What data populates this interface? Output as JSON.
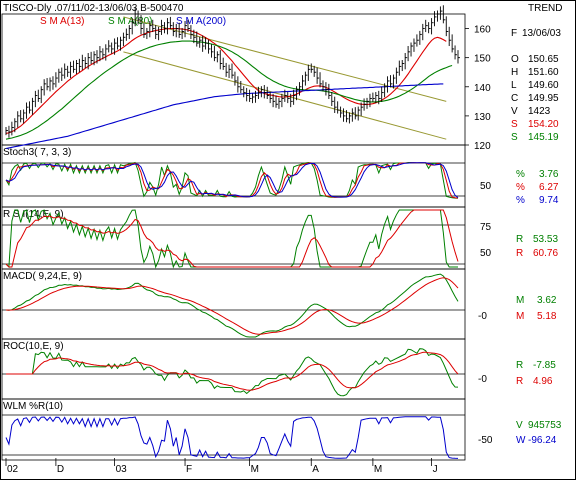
{
  "header": {
    "title": "TISCO-Dly .07/11/02-13/06/03  B-500470",
    "trend_label": "TREND",
    "sma13": "S M A(13)",
    "sma30": "S M A(30)",
    "sma200": "S M A(200)"
  },
  "info": [
    {
      "key": "F",
      "value": "13/06/03",
      "color": "#000000"
    },
    {
      "key": "O",
      "value": "150.65",
      "color": "#000000"
    },
    {
      "key": "H",
      "value": "151.60",
      "color": "#000000"
    },
    {
      "key": "L",
      "value": "149.60",
      "color": "#000000"
    },
    {
      "key": "C",
      "value": "149.95",
      "color": "#000000"
    },
    {
      "key": "V",
      "value": "1423",
      "color": "#000000"
    },
    {
      "key": "S",
      "value": "154.20",
      "color": "#dd0000"
    },
    {
      "key": "S",
      "value": "145.19",
      "color": "#008000"
    }
  ],
  "colors": {
    "sma13": "#dd0000",
    "sma30": "#008000",
    "sma200": "#0000cc",
    "trendline": "#999933",
    "price": "#000000"
  },
  "panels": {
    "stoch": {
      "title": "Stoch3( 7, 3, 3)",
      "axis": [
        "50"
      ],
      "readouts": [
        {
          "key": "%",
          "value": "3.76",
          "color": "#008000"
        },
        {
          "key": "%",
          "value": "6.27",
          "color": "#dd0000"
        },
        {
          "key": "%",
          "value": "9.74",
          "color": "#0000cc"
        }
      ]
    },
    "rsi": {
      "title": "R S I(14,E, 9)",
      "axis": [
        "75",
        "50"
      ],
      "readouts": [
        {
          "key": "R",
          "value": "53.53",
          "color": "#008000"
        },
        {
          "key": "R",
          "value": "60.76",
          "color": "#dd0000"
        }
      ]
    },
    "macd": {
      "title": "MACD( 9,24,E, 9)",
      "axis": [
        "-0"
      ],
      "readouts": [
        {
          "key": "M",
          "value": "3.62",
          "color": "#008000"
        },
        {
          "key": "M",
          "value": "5.18",
          "color": "#dd0000"
        }
      ]
    },
    "roc": {
      "title": "ROC(10,E, 9)",
      "axis": [
        "-0"
      ],
      "readouts": [
        {
          "key": "R",
          "value": "-7.85",
          "color": "#008000"
        },
        {
          "key": "R",
          "value": "4.96",
          "color": "#dd0000"
        }
      ]
    },
    "wlm": {
      "title": "WLM %R(10)",
      "axis": [
        "-50"
      ],
      "readouts": [
        {
          "key": "V",
          "value": "945753",
          "color": "#008000"
        },
        {
          "key": "W",
          "value": "-96.24",
          "color": "#0000cc"
        }
      ]
    }
  },
  "chart_data": {
    "type": "line",
    "ylabel": "",
    "ylim": [
      120,
      165
    ],
    "yticks": [
      "160",
      "150",
      "140",
      "130",
      "120"
    ],
    "x_labels": [
      "02",
      "D",
      "03",
      "F",
      "M",
      "A",
      "M",
      "J"
    ],
    "x_label_index": [
      0,
      17,
      37,
      61,
      83,
      104,
      125,
      145
    ],
    "close": [
      125,
      124.5,
      126,
      128,
      130,
      129,
      131,
      133,
      132,
      135,
      137,
      136,
      139,
      141,
      140,
      142,
      141,
      143,
      145,
      144,
      146,
      145,
      147,
      146,
      148,
      147,
      149,
      148,
      150,
      149,
      151,
      150,
      152,
      151,
      153,
      154,
      153,
      155,
      154,
      156,
      157,
      158,
      160,
      162,
      165,
      163,
      160,
      158,
      159,
      161,
      160,
      158,
      159,
      161,
      160,
      162,
      161,
      159,
      160,
      158,
      159,
      161,
      160,
      158,
      157,
      155,
      156,
      154,
      155,
      153,
      152,
      150,
      151,
      148,
      147,
      145,
      146,
      144,
      142,
      140,
      139,
      138,
      137,
      136,
      136.5,
      137,
      138,
      139,
      138,
      137,
      136,
      135,
      134,
      135,
      136,
      137,
      136,
      135,
      137,
      139,
      140,
      142,
      144,
      146,
      146,
      145,
      143,
      141,
      140,
      139,
      137,
      135,
      133,
      132,
      131,
      130,
      129,
      130,
      131,
      130,
      132,
      133,
      134,
      135,
      136,
      136,
      137,
      136,
      138,
      140,
      142,
      141,
      143,
      145,
      147,
      148,
      150,
      152,
      154,
      155,
      156,
      158,
      160,
      161,
      160,
      162,
      164,
      165,
      166,
      163,
      159,
      156,
      153,
      151,
      150
    ],
    "series": [
      {
        "name": "S M A(13)",
        "values": [
          124,
          124.2,
          124.6,
          125.1,
          125.8,
          126.5,
          127.4,
          128.3,
          129.3,
          130.3,
          131.3,
          132.3,
          133.3,
          134.3,
          135.3,
          136.3,
          137.3,
          138.3,
          139.2,
          140.1,
          141,
          141.9,
          142.7,
          143.5,
          144.2,
          144.9,
          145.6,
          146.3,
          147,
          147.6,
          148.2,
          148.8,
          149.3,
          149.8,
          150.3,
          150.8,
          151.3,
          151.8,
          152.3,
          152.9,
          153.6,
          154.3,
          155.1,
          155.9,
          156.6,
          157.2,
          157.7,
          158.1,
          158.5,
          158.8,
          159.1,
          159.3,
          159.5,
          159.7,
          159.8,
          159.9,
          160,
          160,
          160,
          159.9,
          159.8,
          159.7,
          159.5,
          159.2,
          158.9,
          158.5,
          158,
          157.5,
          156.9,
          156.3,
          155.6,
          154.9,
          154.1,
          153.2,
          152.2,
          151.1,
          150,
          148.9,
          147.6,
          146.4,
          145.2,
          144,
          142.8,
          141.6,
          140.5,
          139.5,
          138.7,
          138.1,
          137.7,
          137.4,
          137.2,
          137,
          136.8,
          136.6,
          136.5,
          136.5,
          136.6,
          136.8,
          137.1,
          137.5,
          138,
          138.5,
          139,
          139.5,
          139.9,
          140.2,
          140.3,
          140.3,
          140.1,
          139.8,
          139.3,
          138.8,
          138.2,
          137.6,
          137,
          136.4,
          135.8,
          135.3,
          134.9,
          134.5,
          134.2,
          134,
          133.9,
          133.9,
          134,
          134.2,
          134.5,
          134.9,
          135.4,
          136,
          136.7,
          137.5,
          138.4,
          139.4,
          140.5,
          141.7,
          143,
          144.4,
          145.9,
          147.4,
          148.9,
          150.4,
          151.9,
          153.3,
          154.7,
          155.9,
          156.7,
          157,
          156.7,
          156.2,
          155.6
        ]
      },
      {
        "name": "S M A(30)",
        "values": [
          122,
          122.2,
          122.4,
          122.7,
          123,
          123.3,
          123.7,
          124.1,
          124.6,
          125.1,
          125.7,
          126.3,
          127,
          127.7,
          128.4,
          129.2,
          130,
          130.8,
          131.6,
          132.4,
          133.3,
          134.2,
          135.1,
          136,
          136.9,
          137.8,
          138.7,
          139.6,
          140.5,
          141.3,
          142.1,
          142.9,
          143.7,
          144.5,
          145.2,
          145.9,
          146.6,
          147.3,
          148,
          148.7,
          149.3,
          149.9,
          150.5,
          151,
          151.5,
          152,
          152.4,
          152.8,
          153.2,
          153.6,
          153.9,
          154.2,
          154.5,
          154.7,
          154.9,
          155.1,
          155.3,
          155.4,
          155.5,
          155.6,
          155.7,
          155.7,
          155.7,
          155.7,
          155.6,
          155.5,
          155.4,
          155.3,
          155.1,
          154.9,
          154.7,
          154.4,
          154.1,
          153.8,
          153.4,
          153,
          152.5,
          152,
          151.4,
          150.8,
          150.1,
          149.4,
          148.6,
          147.8,
          147,
          146.2,
          145.4,
          144.6,
          143.9,
          143.2,
          142.6,
          142,
          141.5,
          141,
          140.6,
          140.2,
          139.9,
          139.6,
          139.4,
          139.2,
          139.1,
          139,
          138.9,
          138.9,
          138.9,
          138.9,
          138.8,
          138.7,
          138.6,
          138.4,
          138.2,
          138,
          137.7,
          137.4,
          137.1,
          136.8,
          136.5,
          136.2,
          135.9,
          135.6,
          135.4,
          135.2,
          135,
          134.9,
          134.8,
          134.8,
          134.8,
          134.9,
          135,
          135.2,
          135.4,
          135.7,
          136,
          136.4,
          136.8,
          137.3,
          137.8,
          138.4,
          139,
          139.7,
          140.4,
          141.1,
          141.9,
          142.7,
          143.5,
          144.2,
          144.8,
          145.3,
          145.8,
          146.2,
          146.6,
          147,
          147.3
        ]
      },
      {
        "name": "S M A(200)",
        "values": [
          118.8,
          119,
          119.2,
          119.4,
          119.6,
          119.8,
          120,
          120.2,
          120.4,
          120.6,
          120.8,
          121,
          121.2,
          121.4,
          121.6,
          121.8,
          122,
          122.2,
          122.4,
          122.6,
          122.8,
          123,
          123.3,
          123.6,
          123.9,
          124.2,
          124.5,
          124.8,
          125.1,
          125.4,
          125.7,
          126,
          126.3,
          126.6,
          126.9,
          127.2,
          127.5,
          127.8,
          128.1,
          128.4,
          128.7,
          129,
          129.3,
          129.6,
          129.9,
          130.2,
          130.5,
          130.8,
          131.1,
          131.4,
          131.7,
          132,
          132.3,
          132.6,
          132.9,
          133.2,
          133.5,
          133.8,
          134,
          134.2,
          134.4,
          134.6,
          134.8,
          135,
          135.2,
          135.4,
          135.6,
          135.8,
          136,
          136.2,
          136.4,
          136.6,
          136.7,
          136.8,
          136.9,
          137,
          137.1,
          137.2,
          137.3,
          137.4,
          137.5,
          137.6,
          137.7,
          137.7,
          137.8,
          137.8,
          137.9,
          137.9,
          138,
          138,
          138.1,
          138.1,
          138.2,
          138.2,
          138.3,
          138.3,
          138.4,
          138.4,
          138.5,
          138.5,
          138.6,
          138.6,
          138.7,
          138.7,
          138.8,
          138.8,
          138.9,
          138.9,
          139,
          139,
          139.1,
          139.1,
          139.2,
          139.2,
          139.3,
          139.3,
          139.4,
          139.4,
          139.5,
          139.5,
          139.6,
          139.6,
          139.7,
          139.7,
          139.8,
          139.8,
          139.9,
          139.9,
          140,
          140,
          140.1,
          140.1,
          140.2,
          140.2,
          140.3,
          140.3,
          140.4,
          140.4,
          140.5,
          140.5,
          140.6,
          140.6,
          140.7,
          140.7,
          140.8,
          140.8,
          140.9,
          140.9,
          141,
          141
        ]
      }
    ],
    "trendlines": [
      {
        "x": [
          40,
          150
        ],
        "y": [
          164,
          135
        ]
      },
      {
        "x": [
          40,
          150
        ],
        "y": [
          152,
          122
        ]
      }
    ]
  }
}
